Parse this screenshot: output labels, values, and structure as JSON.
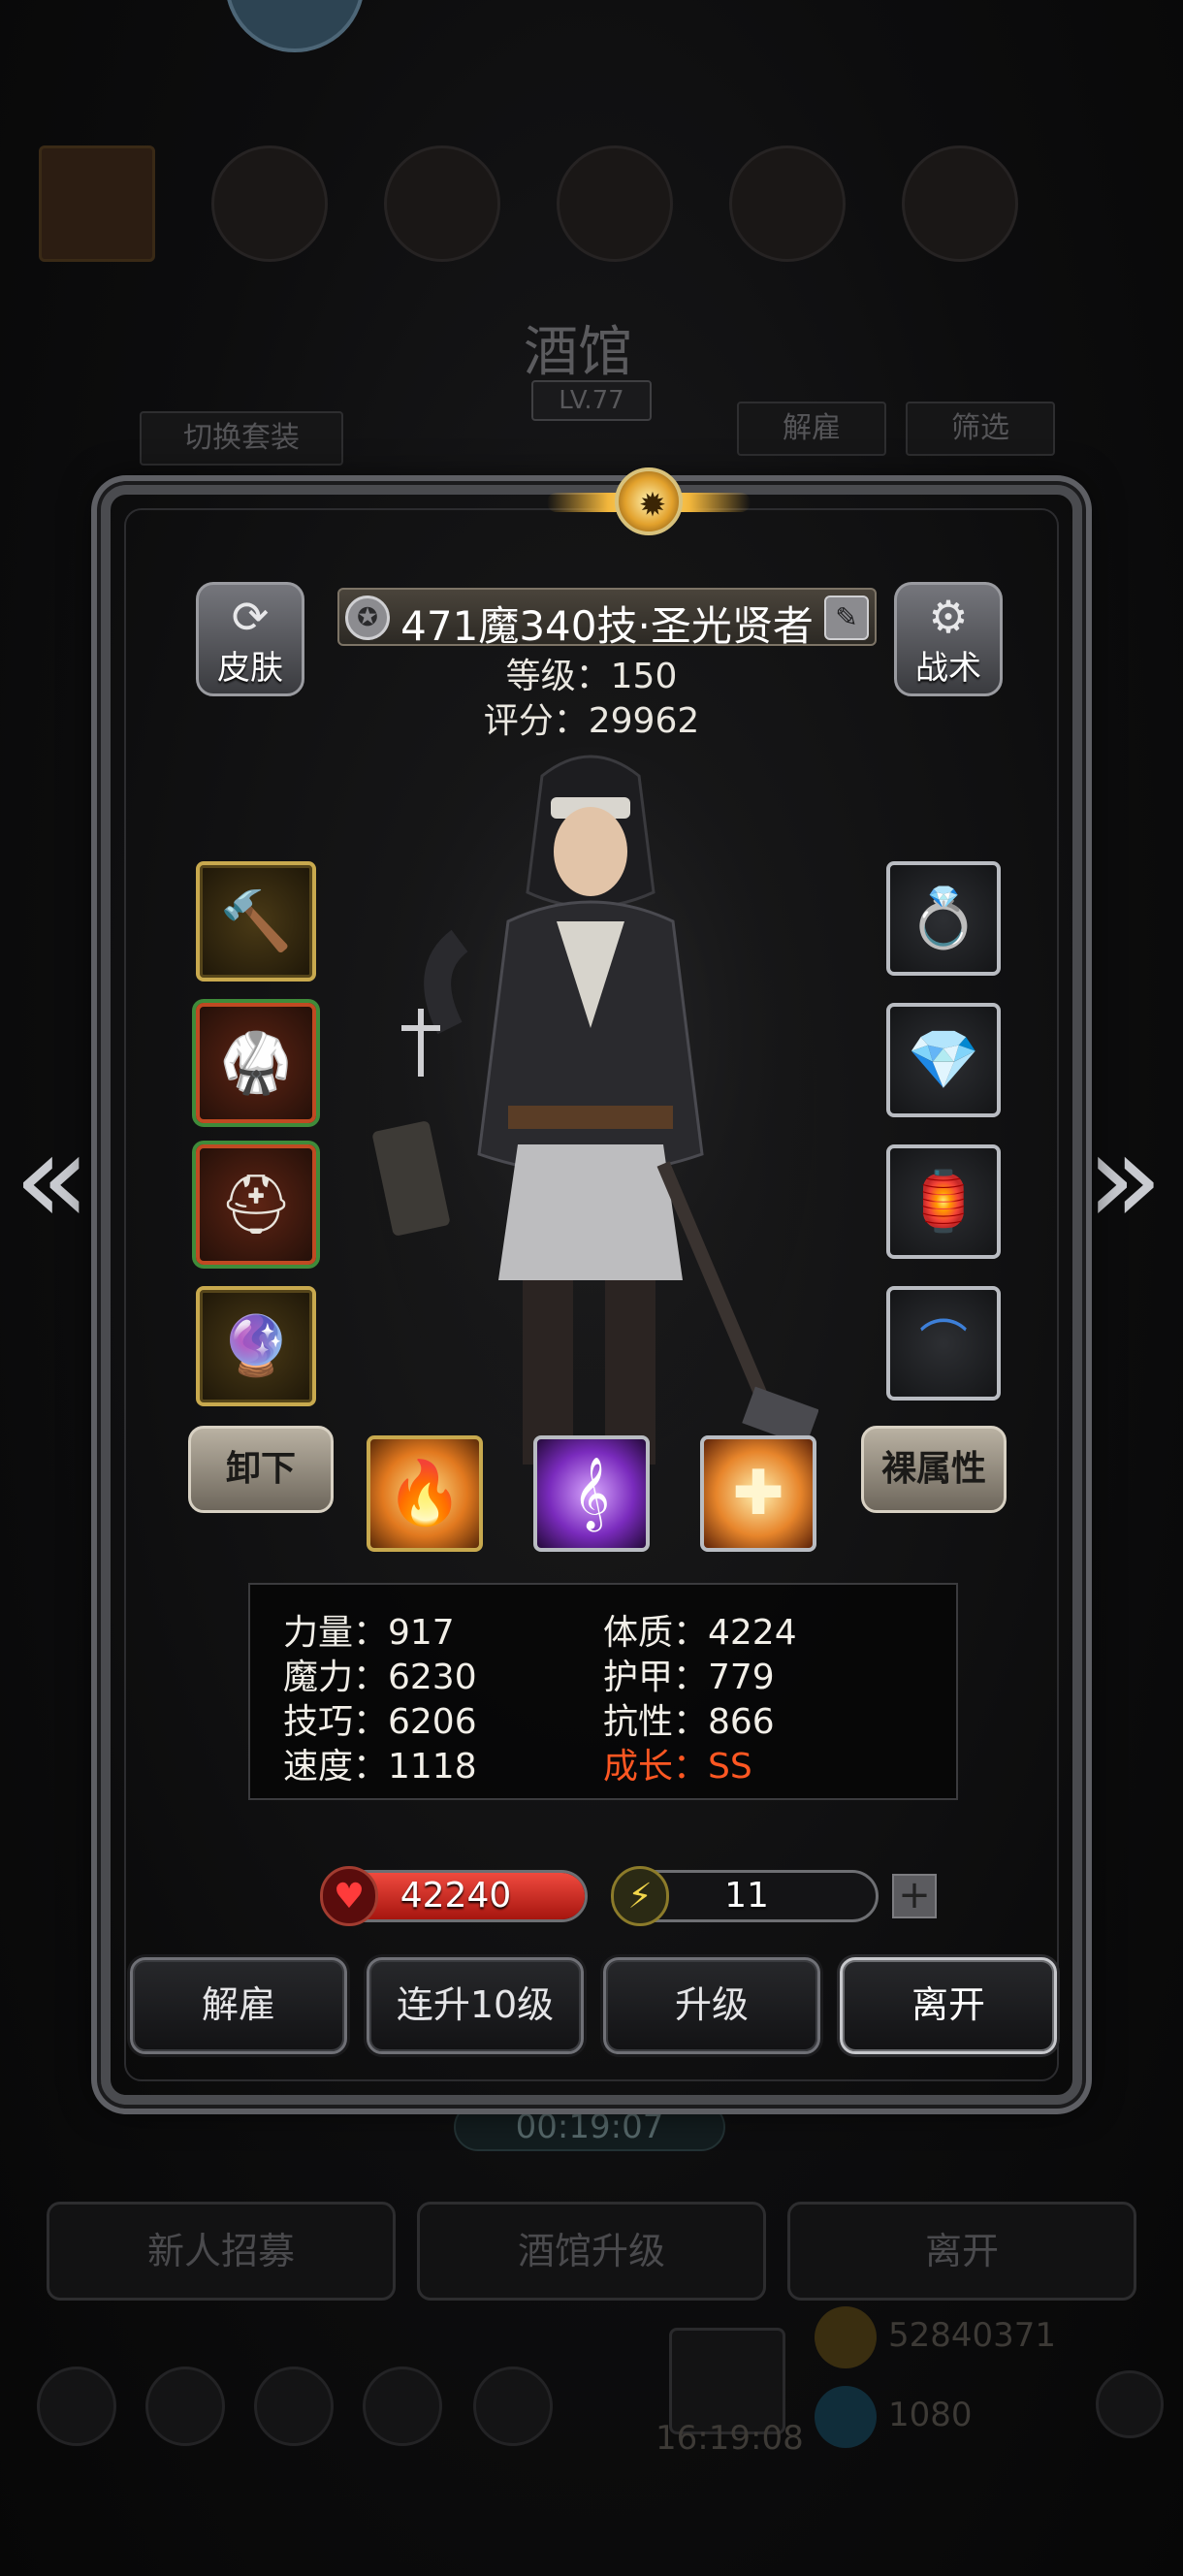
{
  "background": {
    "title": "酒馆",
    "level": "LV.77",
    "switch_outfit": "切换套装",
    "dismiss_tab": "解雇",
    "filter": "筛选",
    "timer": "00:19:07",
    "bottom_buttons": [
      "新人招募",
      "酒馆升级",
      "离开"
    ],
    "clock": "16:19:08",
    "gold": "52840371",
    "gems": "1080"
  },
  "dialog": {
    "skin_label": "皮肤",
    "tactics_label": "战术",
    "hero_name": "471魔340技·圣光贤者",
    "level_text": "等级：150",
    "score_text": "评分：29962",
    "unequip_label": "卸下",
    "base_attr_label": "裸属性",
    "left_equipment": [
      {
        "name": "war-hammer-icon",
        "color": "#c8a94e"
      },
      {
        "name": "robe-armor-icon",
        "color": "#c04a22"
      },
      {
        "name": "helmet-icon",
        "color": "#c04a22"
      },
      {
        "name": "amulet-icon",
        "color": "#c8a94e"
      }
    ],
    "right_equipment": [
      {
        "name": "ring-icon"
      },
      {
        "name": "gem-icon"
      },
      {
        "name": "lantern-icon"
      },
      {
        "name": "empty-slot-icon"
      }
    ],
    "skills": [
      {
        "name": "fire-skill-icon"
      },
      {
        "name": "music-note-skill-icon"
      },
      {
        "name": "holy-cross-skill-icon"
      }
    ],
    "attributes": {
      "strength": "力量：917",
      "constitution": "体质：4224",
      "magic": "魔力：6230",
      "armor": "护甲：779",
      "skill": "技巧：6206",
      "resistance": "抗性：866",
      "speed": "速度：1118",
      "growth": "成长：SS"
    },
    "hp": "42240",
    "energy": "11",
    "energy_fraction": 0.1,
    "actions": {
      "dismiss": "解雇",
      "upgrade10": "连升10级",
      "upgrade": "升级",
      "leave": "离开"
    }
  },
  "colors": {
    "accent": "#ff5722",
    "hp": "#d8231f",
    "energy": "#e8d23a"
  }
}
